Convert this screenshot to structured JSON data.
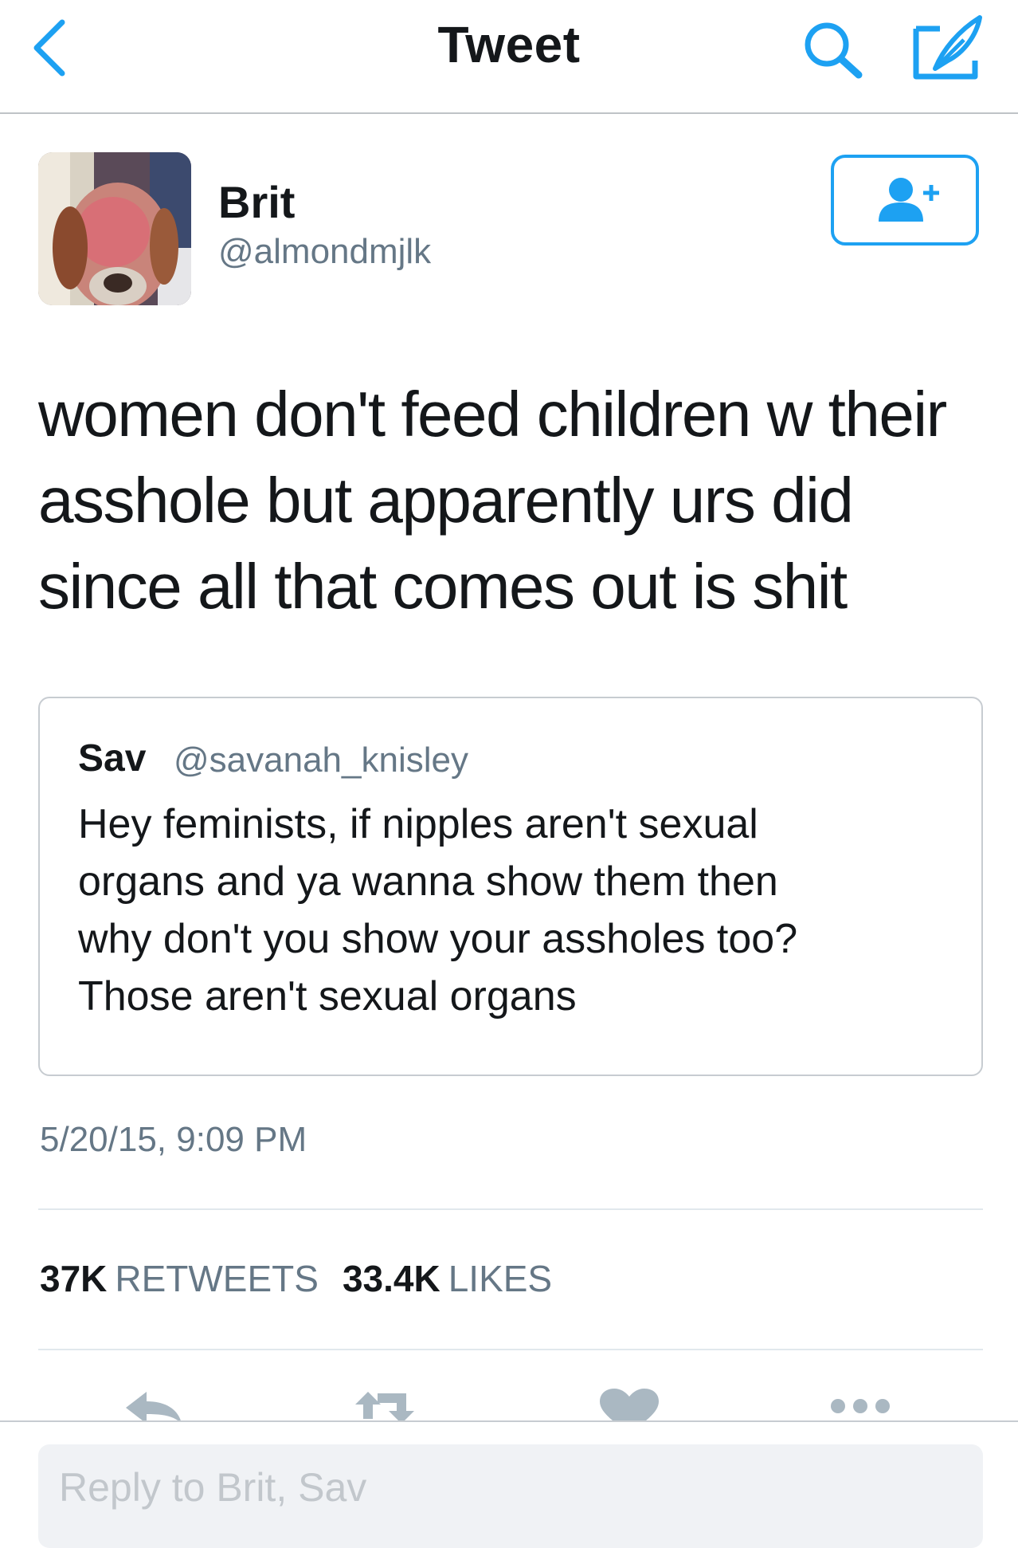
{
  "nav": {
    "title": "Tweet",
    "back_icon": "chevron-left-icon",
    "search_icon": "search-icon",
    "compose_icon": "compose-icon"
  },
  "author": {
    "name": "Brit",
    "handle": "@almondmjlk",
    "follow_icon": "add-user-icon"
  },
  "tweet": {
    "lines": [
      "women don't feed children w their",
      "asshole but apparently urs did",
      "since all that comes out is shit"
    ]
  },
  "quoted_tweet": {
    "name": "Sav",
    "handle": "@savanah_knisley",
    "lines": [
      "Hey feminists, if nipples aren't sexual",
      "organs and ya wanna show them then",
      "why don't you show your assholes too?",
      "Those aren't sexual organs"
    ]
  },
  "timestamp": "5/20/15, 9:09 PM",
  "stats": {
    "retweets_count": "37K",
    "retweets_label": "RETWEETS",
    "likes_count": "33.4K",
    "likes_label": "LIKES"
  },
  "actions": [
    "reply-icon",
    "retweet-icon",
    "heart-icon",
    "more-icon"
  ],
  "reply": {
    "placeholder": "Reply to Brit, Sav"
  },
  "colors": {
    "accent": "#1da1f2",
    "icon_gray": "#aab8c2",
    "secondary_text": "#657786"
  }
}
